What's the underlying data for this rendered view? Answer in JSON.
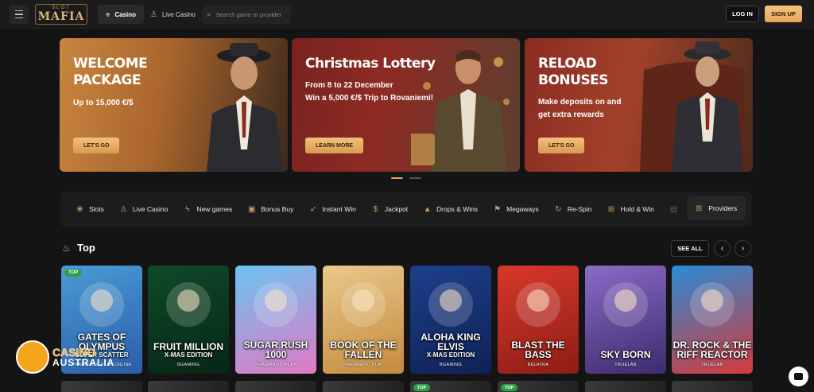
{
  "header": {
    "logo_small": "SLOT",
    "logo_big": "MAFIA",
    "tabs": [
      {
        "label": "Casino",
        "icon": "spade-icon",
        "active": true
      },
      {
        "label": "Live Casino",
        "icon": "dealer-icon",
        "active": false
      }
    ],
    "search_placeholder": "Search game or provider",
    "login_label": "LOG IN",
    "signup_label": "SIGN UP"
  },
  "banners": [
    {
      "title_line1": "WELCOME",
      "title_line2": "PACKAGE",
      "desc_line1": "Up to 15,000 €/$",
      "desc_line2": "",
      "cta": "LET'S GO",
      "bg": "#b9773a"
    },
    {
      "title_line1": "Christmas Lottery",
      "title_line2": "",
      "desc_line1": "From 8 to 22 December",
      "desc_line2": "Win a 5,000 €/$ Trip to Rovaniemi!",
      "cta": "LEARN MORE",
      "bg": "#8a2a26"
    },
    {
      "title_line1": "RELOAD",
      "title_line2": "BONUSES",
      "desc_line1": "Make deposits on and",
      "desc_line2": "get extra rewards",
      "cta": "LET'S GO",
      "bg": "#9a3a2c"
    }
  ],
  "carousel": {
    "active_index": 0,
    "count": 2
  },
  "categories": [
    {
      "label": "Slots",
      "icon": "cherries-icon"
    },
    {
      "label": "Live Casino",
      "icon": "dealer-icon"
    },
    {
      "label": "New games",
      "icon": "lightning-icon"
    },
    {
      "label": "Bonus Buy",
      "icon": "gift-icon"
    },
    {
      "label": "Instant Win",
      "icon": "rocket-icon"
    },
    {
      "label": "Jackpot",
      "icon": "moneybag-icon"
    },
    {
      "label": "Drops & Wins",
      "icon": "pyramid-icon"
    },
    {
      "label": "Megaways",
      "icon": "flag-icon"
    },
    {
      "label": "Re-Spin",
      "icon": "respin-icon"
    },
    {
      "label": "Hold & Win",
      "icon": "grid-icon"
    }
  ],
  "providers_label": "Providers",
  "section": {
    "title": "Top",
    "see_all": "SEE ALL"
  },
  "games": [
    {
      "name": "GATES OF OLYMPUS",
      "sub": "SUPER SCATTER",
      "provider": "PRAGMATIC PLAY ONLINE",
      "badge": "TOP",
      "color1": "#4b9bd6",
      "color2": "#2a5ea8"
    },
    {
      "name": "FRUIT MILLION",
      "sub": "X-MAS EDITION",
      "provider": "BGAMING",
      "badge": "",
      "color1": "#0f4a2a",
      "color2": "#062615"
    },
    {
      "name": "SUGAR RUSH 1000",
      "sub": "",
      "provider": "PRAGMATIC PLAY",
      "badge": "",
      "color1": "#6bc4f0",
      "color2": "#e07ac4"
    },
    {
      "name": "BOOK OF THE FALLEN",
      "sub": "",
      "provider": "PRAGMATIC PLAY",
      "badge": "",
      "color1": "#e9c98a",
      "color2": "#c58a3e"
    },
    {
      "name": "ALOHA KING ELVIS",
      "sub": "X-MAS EDITION",
      "provider": "BGAMING",
      "badge": "",
      "color1": "#1d3f8a",
      "color2": "#0e2257"
    },
    {
      "name": "BLAST THE BASS",
      "sub": "",
      "provider": "BELATRA",
      "badge": "",
      "color1": "#d9382a",
      "color2": "#8c1d16"
    },
    {
      "name": "SKY BORN",
      "sub": "",
      "provider": "TRUELAB",
      "badge": "",
      "color1": "#8a6bc7",
      "color2": "#3d2b6e"
    },
    {
      "name": "DR. ROCK & THE RIFF REACTOR",
      "sub": "",
      "provider": "TRUELAB",
      "badge": "",
      "color1": "#2a8bd6",
      "color2": "#d63a3a"
    }
  ],
  "row2_badges": [
    "",
    "",
    "",
    "",
    "TOP",
    "TOP",
    "",
    ""
  ],
  "watermark": {
    "line1": "CASINO",
    "line2": "AUSTRALIA"
  }
}
